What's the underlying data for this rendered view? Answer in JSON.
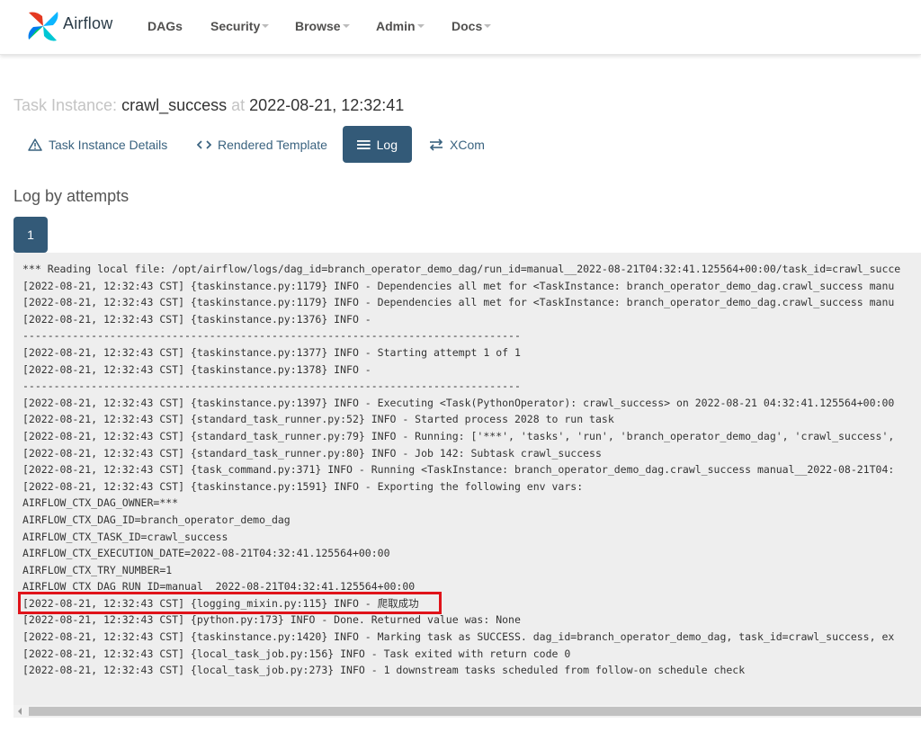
{
  "brand": {
    "name": "Airflow"
  },
  "nav": {
    "items": [
      {
        "label": "DAGs",
        "dropdown": false
      },
      {
        "label": "Security",
        "dropdown": true
      },
      {
        "label": "Browse",
        "dropdown": true
      },
      {
        "label": "Admin",
        "dropdown": true
      },
      {
        "label": "Docs",
        "dropdown": true
      }
    ]
  },
  "page": {
    "title_prefix": "Task Instance:",
    "task_id": "crawl_success",
    "title_at": "at",
    "execution_date": "2022-08-21, 12:32:41"
  },
  "tabs": [
    {
      "label": "Task Instance Details",
      "icon": "warning-triangle-icon",
      "active": false
    },
    {
      "label": "Rendered Template",
      "icon": "code-brackets-icon",
      "active": false
    },
    {
      "label": "Log",
      "icon": "list-lines-icon",
      "active": true
    },
    {
      "label": "XCom",
      "icon": "swap-arrows-icon",
      "active": false
    }
  ],
  "log_section": {
    "heading": "Log by attempts",
    "attempts": [
      "1"
    ],
    "lines": [
      "*** Reading local file: /opt/airflow/logs/dag_id=branch_operator_demo_dag/run_id=manual__2022-08-21T04:32:41.125564+00:00/task_id=crawl_succe",
      "[2022-08-21, 12:32:43 CST] {taskinstance.py:1179} INFO - Dependencies all met for <TaskInstance: branch_operator_demo_dag.crawl_success manu",
      "[2022-08-21, 12:32:43 CST] {taskinstance.py:1179} INFO - Dependencies all met for <TaskInstance: branch_operator_demo_dag.crawl_success manu",
      "[2022-08-21, 12:32:43 CST] {taskinstance.py:1376} INFO -",
      "--------------------------------------------------------------------------------",
      "[2022-08-21, 12:32:43 CST] {taskinstance.py:1377} INFO - Starting attempt 1 of 1",
      "[2022-08-21, 12:32:43 CST] {taskinstance.py:1378} INFO -",
      "--------------------------------------------------------------------------------",
      "[2022-08-21, 12:32:43 CST] {taskinstance.py:1397} INFO - Executing <Task(PythonOperator): crawl_success> on 2022-08-21 04:32:41.125564+00:00",
      "[2022-08-21, 12:32:43 CST] {standard_task_runner.py:52} INFO - Started process 2028 to run task",
      "[2022-08-21, 12:32:43 CST] {standard_task_runner.py:79} INFO - Running: ['***', 'tasks', 'run', 'branch_operator_demo_dag', 'crawl_success',",
      "[2022-08-21, 12:32:43 CST] {standard_task_runner.py:80} INFO - Job 142: Subtask crawl_success",
      "[2022-08-21, 12:32:43 CST] {task_command.py:371} INFO - Running <TaskInstance: branch_operator_demo_dag.crawl_success manual__2022-08-21T04:",
      "[2022-08-21, 12:32:43 CST] {taskinstance.py:1591} INFO - Exporting the following env vars:",
      "AIRFLOW_CTX_DAG_OWNER=***",
      "AIRFLOW_CTX_DAG_ID=branch_operator_demo_dag",
      "AIRFLOW_CTX_TASK_ID=crawl_success",
      "AIRFLOW_CTX_EXECUTION_DATE=2022-08-21T04:32:41.125564+00:00",
      "AIRFLOW_CTX_TRY_NUMBER=1",
      "AIRFLOW_CTX_DAG_RUN_ID=manual__2022-08-21T04:32:41.125564+00:00",
      "[2022-08-21, 12:32:43 CST] {logging_mixin.py:115} INFO - 爬取成功",
      "[2022-08-21, 12:32:43 CST] {python.py:173} INFO - Done. Returned value was: None",
      "[2022-08-21, 12:32:43 CST] {taskinstance.py:1420} INFO - Marking task as SUCCESS. dag_id=branch_operator_demo_dag, task_id=crawl_success, ex",
      "[2022-08-21, 12:32:43 CST] {local_task_job.py:156} INFO - Task exited with return code 0",
      "[2022-08-21, 12:32:43 CST] {local_task_job.py:273} INFO - 1 downstream tasks scheduled from follow-on schedule check"
    ]
  },
  "colors": {
    "primary": "#335a78",
    "link": "#39627f",
    "highlight_border": "#e0131a"
  }
}
